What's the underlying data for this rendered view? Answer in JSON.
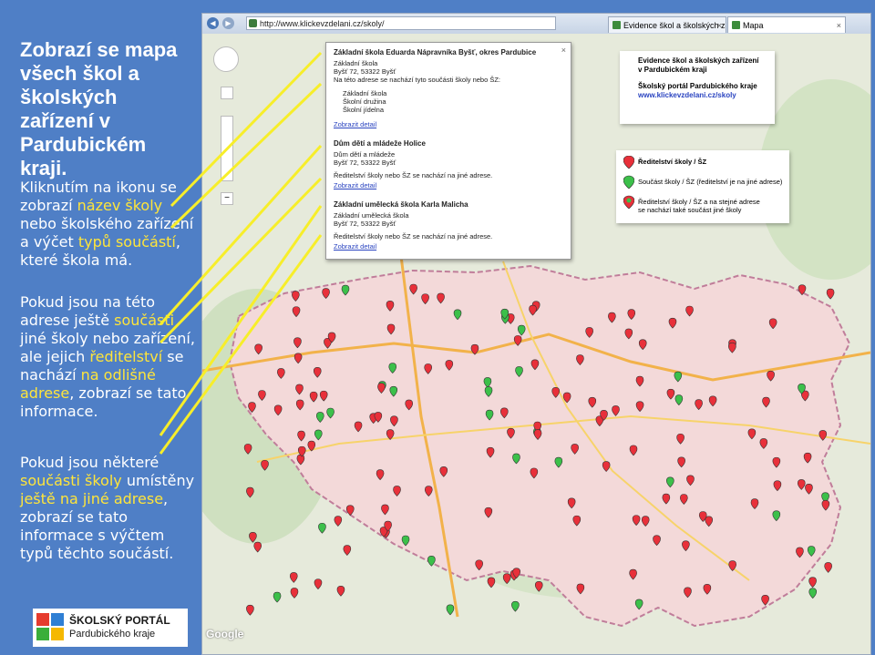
{
  "left_panel": {
    "title": "Zobrazí se mapa všech škol a školských zařízení v Pardubickém kraji.",
    "p1_a": "Kliknutím na ikonu se zobrazí ",
    "p1_b": "název školy",
    "p1_c": " nebo školského zařízení a výčet ",
    "p1_d": "typů součástí",
    "p1_e": ", které škola má.",
    "p2_a": "Pokud jsou na této adrese ještě ",
    "p2_b": "součásti",
    "p2_c": " jiné školy nebo zařízení, ale jejich ",
    "p2_d": "ředitelství",
    "p2_e": " se nachází ",
    "p2_f": "na odlišné adrese",
    "p2_g": ", zobrazí se tato informace.",
    "p3_a": "Pokud jsou některé ",
    "p3_b": "součásti školy",
    "p3_c": " umístěny ",
    "p3_d": "ještě na jiné adrese",
    "p3_e": ", zobrazí se tato informace s výčtem typů těchto součástí.",
    "logo_line1": "ŠKOLSKÝ PORTÁL",
    "logo_line2": "Pardubického kraje"
  },
  "browser": {
    "url": "http://www.klickevzdelani.cz/skoly/",
    "tab1": "Evidence škol a školských zaří...",
    "tab2": "Mapa"
  },
  "infowindow": {
    "s1_title": "Základní škola Eduarda Nápravníka Byšť, okres Pardubice",
    "s1_l1": "Základní škola",
    "s1_l2": "Byšť 72, 53322 Byšť",
    "s1_l3": "Na této adrese se nachází tyto součásti školy nebo ŠZ:",
    "s1_items": [
      "Základní škola",
      "Školní družina",
      "Školní jídelna"
    ],
    "s1_link": "Zobrazit detail",
    "s2_title": "Dům dětí a mládeže Holice",
    "s2_l1": "Dům dětí a mládeže",
    "s2_l2": "Byšť 72, 53322 Byšť",
    "s2_l3": "Ředitelství školy nebo ŠZ se nachází na jiné adrese.",
    "s2_link": "Zobrazit detail",
    "s3_title": "Základní umělecká škola Karla Malicha",
    "s3_l1": "Základní umělecká škola",
    "s3_l2": "Byšť 72, 53322 Byšť",
    "s3_l3": "Ředitelství školy nebo ŠZ se nachází na jiné adrese.",
    "s3_link": "Zobrazit detail"
  },
  "legend_top": {
    "l1": "Evidence škol a školských zařízení",
    "l2": "v Pardubickém kraji",
    "l3": "Školský portál Pardubického kraje",
    "l4": "www.klickevzdelani.cz/skoly"
  },
  "legend_markers": {
    "red": "Ředitelství školy / ŠZ",
    "green": "Součást školy / ŠZ (ředitelství je na jiné adrese)",
    "mixed_a": "Ředitelství školy / ŠZ a na stejné adrese",
    "mixed_b": "se nachází také součást jiné školy"
  },
  "colors": {
    "panel": "#4f7fc6",
    "highlight": "#ffe53a",
    "marker_red": "#e8303a",
    "marker_green": "#3cc04a",
    "region": "#f3d9d9"
  },
  "google": "Google"
}
